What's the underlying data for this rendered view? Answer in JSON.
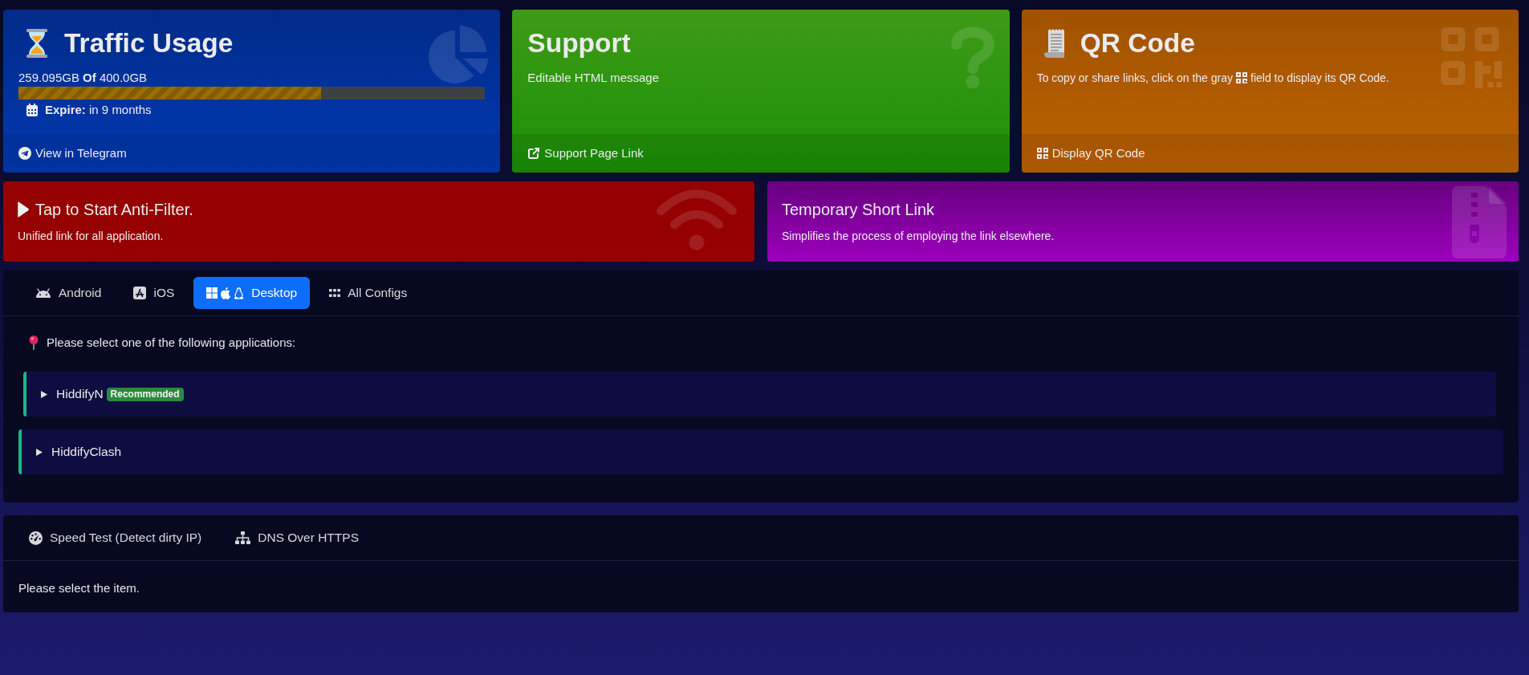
{
  "traffic_card": {
    "title": "Traffic Usage",
    "usage": "259.095GB **Of** 400.0GB",
    "level": 0.648,
    "expire": "**Expire:** in 9 months",
    "link": "View in Telegram"
  },
  "support_card": {
    "title": "Support",
    "message": "Editable HTML message",
    "link": "Support Page Link"
  },
  "qr_card": {
    "title": "QR Code",
    "message_start": "To copy or share links, click on the gray",
    "message_end": "field to display its QR Code.",
    "link": "Display QR Code"
  },
  "anti_filter_card": {
    "title": "Tap to Start Anti-Filter.",
    "subtitle": "Unified link for all application."
  },
  "short_link_card": {
    "title": "Temporary Short Link",
    "subtitle": "Simplifies the process of employing the link elsewhere."
  },
  "app_panel": {
    "tabs": [
      {
        "label": "Android",
        "selected": false
      },
      {
        "label": "iOS",
        "selected": false
      },
      {
        "label": "Desktop",
        "selected": true
      },
      {
        "label": "All Configs",
        "selected": false
      }
    ],
    "prompt": "Please select one of the following applications:",
    "apps": [
      {
        "name": "HiddifyN",
        "badge": "Recommended",
        "expanded": false
      },
      {
        "name": "HiddifyClash",
        "expanded": false
      }
    ]
  },
  "tools_panel": {
    "tabs": [
      {
        "label": "Speed Test (Detect dirty IP)",
        "selected": false
      },
      {
        "label": "DNS Over HTTPS",
        "selected": false
      }
    ],
    "message": "Please select the item."
  }
}
